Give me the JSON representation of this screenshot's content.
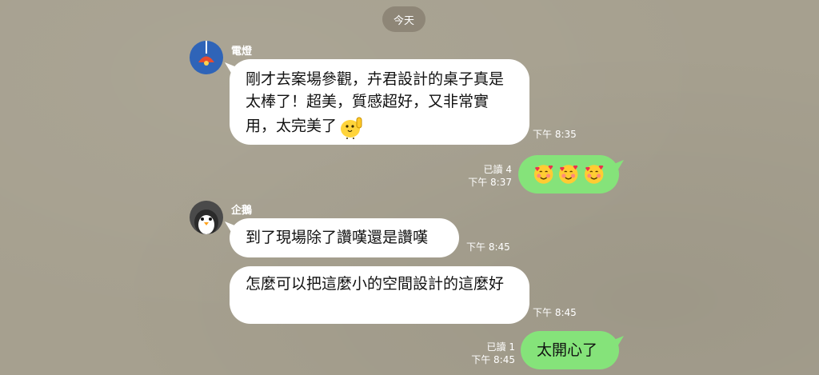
{
  "date_divider": "今天",
  "contacts": {
    "first": {
      "name": "電燈",
      "avatar_icon": "lamp-icon",
      "avatar_color": "#2f64b8"
    },
    "second": {
      "name": "企鵝",
      "avatar_icon": "penguin-icon",
      "avatar_color": "#4a4a4a"
    }
  },
  "messages": [
    {
      "sender": "電燈",
      "direction": "incoming",
      "text": "剛才去案場參觀，卉君設計的桌子真是太棒了！超美，質感超好，又非常實用，太完美了",
      "sticker": "thumbs-up-chick-sticker",
      "time": "下午 8:35"
    },
    {
      "direction": "outgoing",
      "emojis": [
        "smiling-face-with-hearts-icon",
        "smiling-face-with-hearts-icon",
        "smiling-face-with-hearts-icon"
      ],
      "read": "已讀 4",
      "time": "下午 8:37"
    },
    {
      "sender": "企鵝",
      "direction": "incoming",
      "text": "到了現場除了讚嘆還是讚嘆",
      "time": "下午 8:45"
    },
    {
      "sender": "企鵝",
      "direction": "incoming",
      "text": "怎麼可以把這麼小的空間設計的這麼好",
      "time": "下午 8:45"
    },
    {
      "direction": "outgoing",
      "text": "太開心了",
      "read": "已讀 1",
      "time": "下午 8:45"
    }
  ],
  "colors": {
    "background": "#a6a08f",
    "incoming_bubble": "#ffffff",
    "outgoing_bubble": "#85e37a"
  }
}
